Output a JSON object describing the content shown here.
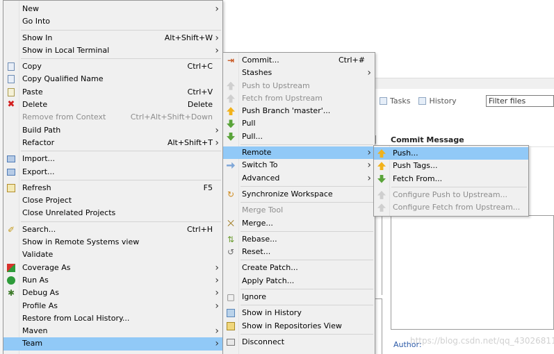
{
  "background": {
    "tabs": [
      {
        "label": "Tasks",
        "icon": "tasks-icon"
      },
      {
        "label": "History",
        "icon": "history-icon"
      }
    ],
    "filter_placeholder": "Filter files",
    "commit_column": "Commit Message",
    "author_label": "Author:",
    "watermark": "https://blog.csdn.net/qq_43026811"
  },
  "context_menu": {
    "items": [
      {
        "label": "New",
        "shortcut": "",
        "submenu": true,
        "icon": "",
        "enabled": true
      },
      {
        "label": "Go Into",
        "shortcut": "",
        "submenu": false,
        "icon": "",
        "enabled": true
      },
      {
        "sep": true
      },
      {
        "label": "Show In",
        "shortcut": "Alt+Shift+W",
        "submenu": true,
        "icon": "",
        "enabled": true
      },
      {
        "label": "Show in Local Terminal",
        "shortcut": "",
        "submenu": true,
        "icon": "",
        "enabled": true
      },
      {
        "sep": true
      },
      {
        "label": "Copy",
        "shortcut": "Ctrl+C",
        "submenu": false,
        "icon": "copy-icon",
        "enabled": true
      },
      {
        "label": "Copy Qualified Name",
        "shortcut": "",
        "submenu": false,
        "icon": "copy-qualified-name-icon",
        "enabled": true
      },
      {
        "label": "Paste",
        "shortcut": "Ctrl+V",
        "submenu": false,
        "icon": "paste-icon",
        "enabled": true
      },
      {
        "label": "Delete",
        "shortcut": "Delete",
        "submenu": false,
        "icon": "delete-icon",
        "enabled": true
      },
      {
        "label": "Remove from Context",
        "shortcut": "Ctrl+Alt+Shift+Down",
        "submenu": false,
        "icon": "remove-from-context-icon",
        "enabled": false
      },
      {
        "label": "Build Path",
        "shortcut": "",
        "submenu": true,
        "icon": "",
        "enabled": true
      },
      {
        "label": "Refactor",
        "shortcut": "Alt+Shift+T",
        "submenu": true,
        "icon": "",
        "enabled": true
      },
      {
        "sep": true
      },
      {
        "label": "Import...",
        "shortcut": "",
        "submenu": false,
        "icon": "import-icon",
        "enabled": true
      },
      {
        "label": "Export...",
        "shortcut": "",
        "submenu": false,
        "icon": "export-icon",
        "enabled": true
      },
      {
        "sep": true
      },
      {
        "label": "Refresh",
        "shortcut": "F5",
        "submenu": false,
        "icon": "refresh-icon",
        "enabled": true
      },
      {
        "label": "Close Project",
        "shortcut": "",
        "submenu": false,
        "icon": "",
        "enabled": true
      },
      {
        "label": "Close Unrelated Projects",
        "shortcut": "",
        "submenu": false,
        "icon": "",
        "enabled": true
      },
      {
        "sep": true
      },
      {
        "label": "Search...",
        "shortcut": "Ctrl+H",
        "submenu": false,
        "icon": "search-icon",
        "enabled": true
      },
      {
        "label": "Show in Remote Systems view",
        "shortcut": "",
        "submenu": false,
        "icon": "",
        "enabled": true
      },
      {
        "label": "Validate",
        "shortcut": "",
        "submenu": false,
        "icon": "",
        "enabled": true
      },
      {
        "label": "Coverage As",
        "shortcut": "",
        "submenu": true,
        "icon": "coverage-icon",
        "enabled": true
      },
      {
        "label": "Run As",
        "shortcut": "",
        "submenu": true,
        "icon": "run-icon",
        "enabled": true
      },
      {
        "label": "Debug As",
        "shortcut": "",
        "submenu": true,
        "icon": "debug-icon",
        "enabled": true
      },
      {
        "label": "Profile As",
        "shortcut": "",
        "submenu": true,
        "icon": "",
        "enabled": true
      },
      {
        "label": "Restore from Local History...",
        "shortcut": "",
        "submenu": false,
        "icon": "",
        "enabled": true
      },
      {
        "label": "Maven",
        "shortcut": "",
        "submenu": true,
        "icon": "",
        "enabled": true
      },
      {
        "label": "Team",
        "shortcut": "",
        "submenu": true,
        "icon": "",
        "enabled": true,
        "highlighted": true
      }
    ]
  },
  "team_menu": {
    "items": [
      {
        "label": "Commit...",
        "shortcut": "Ctrl+#",
        "submenu": false,
        "icon": "commit-icon",
        "enabled": true
      },
      {
        "label": "Stashes",
        "shortcut": "",
        "submenu": true,
        "icon": "",
        "enabled": true
      },
      {
        "label": "Push to Upstream",
        "shortcut": "",
        "submenu": false,
        "icon": "push-upstream-icon",
        "enabled": false
      },
      {
        "label": "Fetch from Upstream",
        "shortcut": "",
        "submenu": false,
        "icon": "fetch-upstream-icon",
        "enabled": false
      },
      {
        "label": "Push Branch 'master'...",
        "shortcut": "",
        "submenu": false,
        "icon": "push-branch-icon",
        "enabled": true
      },
      {
        "label": "Pull",
        "shortcut": "",
        "submenu": false,
        "icon": "pull-icon",
        "enabled": true
      },
      {
        "label": "Pull...",
        "shortcut": "",
        "submenu": false,
        "icon": "pull-dialog-icon",
        "enabled": true
      },
      {
        "sep": true
      },
      {
        "label": "Remote",
        "shortcut": "",
        "submenu": true,
        "icon": "",
        "enabled": true,
        "highlighted": true
      },
      {
        "label": "Switch To",
        "shortcut": "",
        "submenu": true,
        "icon": "switch-icon",
        "enabled": true
      },
      {
        "label": "Advanced",
        "shortcut": "",
        "submenu": true,
        "icon": "",
        "enabled": true
      },
      {
        "sep": true
      },
      {
        "label": "Synchronize Workspace",
        "shortcut": "",
        "submenu": false,
        "icon": "synchronize-icon",
        "enabled": true
      },
      {
        "sep": true
      },
      {
        "label": "Merge Tool",
        "shortcut": "",
        "submenu": false,
        "icon": "merge-tool-icon",
        "enabled": false
      },
      {
        "label": "Merge...",
        "shortcut": "",
        "submenu": false,
        "icon": "merge-icon",
        "enabled": true
      },
      {
        "sep": true
      },
      {
        "label": "Rebase...",
        "shortcut": "",
        "submenu": false,
        "icon": "rebase-icon",
        "enabled": true
      },
      {
        "label": "Reset...",
        "shortcut": "",
        "submenu": false,
        "icon": "reset-icon",
        "enabled": true
      },
      {
        "sep": true
      },
      {
        "label": "Create Patch...",
        "shortcut": "",
        "submenu": false,
        "icon": "",
        "enabled": true
      },
      {
        "label": "Apply Patch...",
        "shortcut": "",
        "submenu": false,
        "icon": "",
        "enabled": true
      },
      {
        "sep": true
      },
      {
        "label": "Ignore",
        "shortcut": "",
        "submenu": false,
        "icon": "ignore-icon",
        "enabled": true
      },
      {
        "sep": true
      },
      {
        "label": "Show in History",
        "shortcut": "",
        "submenu": false,
        "icon": "history-icon",
        "enabled": true
      },
      {
        "label": "Show in Repositories View",
        "shortcut": "",
        "submenu": false,
        "icon": "repository-icon",
        "enabled": true
      },
      {
        "sep": true
      },
      {
        "label": "Disconnect",
        "shortcut": "",
        "submenu": false,
        "icon": "disconnect-icon",
        "enabled": true
      }
    ]
  },
  "remote_menu": {
    "items": [
      {
        "label": "Push...",
        "icon": "push-icon",
        "enabled": true,
        "highlighted": true
      },
      {
        "label": "Push Tags...",
        "icon": "push-tags-icon",
        "enabled": true
      },
      {
        "label": "Fetch From...",
        "icon": "fetch-icon",
        "enabled": true
      },
      {
        "sep": true
      },
      {
        "label": "Configure Push to Upstream...",
        "icon": "configure-push-icon",
        "enabled": false
      },
      {
        "label": "Configure Fetch from Upstream...",
        "icon": "configure-fetch-icon",
        "enabled": false
      }
    ]
  }
}
